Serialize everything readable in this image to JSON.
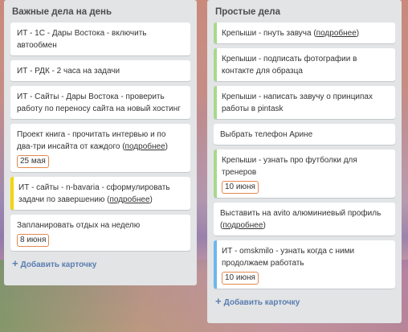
{
  "lists": [
    {
      "title": "Важные дела на день",
      "cards": [
        {
          "text": "ИТ - 1С - Дары Востока - включить автообмен"
        },
        {
          "text": "ИТ - РДК - 2 часа на задачи"
        },
        {
          "text": "ИТ - Сайты - Дары Востока - проверить работу по переносу сайта на новый хостинг"
        },
        {
          "text": "Проект книга - прочитать интервью и по два-три инсайта от каждого (",
          "more": "подробнее",
          "after": ")",
          "badge": "25 мая"
        },
        {
          "text": "ИТ - сайты - n-bavaria - сформулировать задачи по завершению (",
          "more": "подробнее",
          "after": ")",
          "label_color": "yellow"
        },
        {
          "text": "Запланировать отдых на неделю",
          "badge": "8 июня"
        }
      ],
      "add_label": "Добавить карточку"
    },
    {
      "title": "Простые дела",
      "cards": [
        {
          "text": "Крепыши - пнуть завуча (",
          "more": "подробнее",
          "after": ")",
          "label_color": "green"
        },
        {
          "text": "Крепыши - подписать фотографии в контакте для образца",
          "label_color": "green"
        },
        {
          "text": "Крепыши - написать завучу о принципах работы в pintask",
          "label_color": "green"
        },
        {
          "text": "Выбрать телефон Арине"
        },
        {
          "text": "Крепыши - узнать про футболки для тренеров",
          "badge": "10 июня",
          "label_color": "green"
        },
        {
          "text": "Выставить на avito алюминиевый профиль (",
          "more": "подробнее",
          "after": ")"
        },
        {
          "text": "ИТ - omskmilo - узнать когда с ними продолжаем работать",
          "badge": "10 июня",
          "label_color": "blue"
        }
      ],
      "add_label": "Добавить карточку"
    }
  ],
  "colors": {
    "list_bg": "#e2e4e6",
    "label_green": "#a7d98c",
    "label_yellow": "#f2d600",
    "label_blue": "#6cb7ef",
    "due_border": "#e3884f",
    "link": "#5b7db0"
  }
}
